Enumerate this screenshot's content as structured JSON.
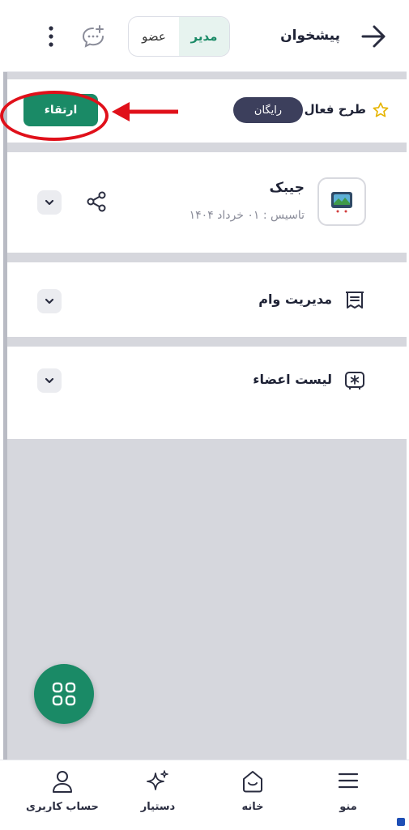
{
  "header": {
    "title": "پیشخوان",
    "segments": {
      "admin": "مدیر",
      "member": "عضو"
    }
  },
  "plan": {
    "label": "طرح فعال",
    "badge": "رایگان",
    "upgrade_label": "ارتقاء"
  },
  "group": {
    "name": "جیبک",
    "founded": "تاسیس : ۰۱ خرداد ۱۴۰۴"
  },
  "rows": [
    {
      "label": "مدیریت وام"
    },
    {
      "label": "لیست اعضاء"
    }
  ],
  "bottom_nav": {
    "menu": "منو",
    "home": "خانه",
    "assistant": "دستیار",
    "account": "حساب کاربری"
  },
  "colors": {
    "accent": "#1a8a66",
    "badge_bg": "#3c3f5c",
    "annotation": "#e0101a",
    "background": "#d6d7dd"
  }
}
